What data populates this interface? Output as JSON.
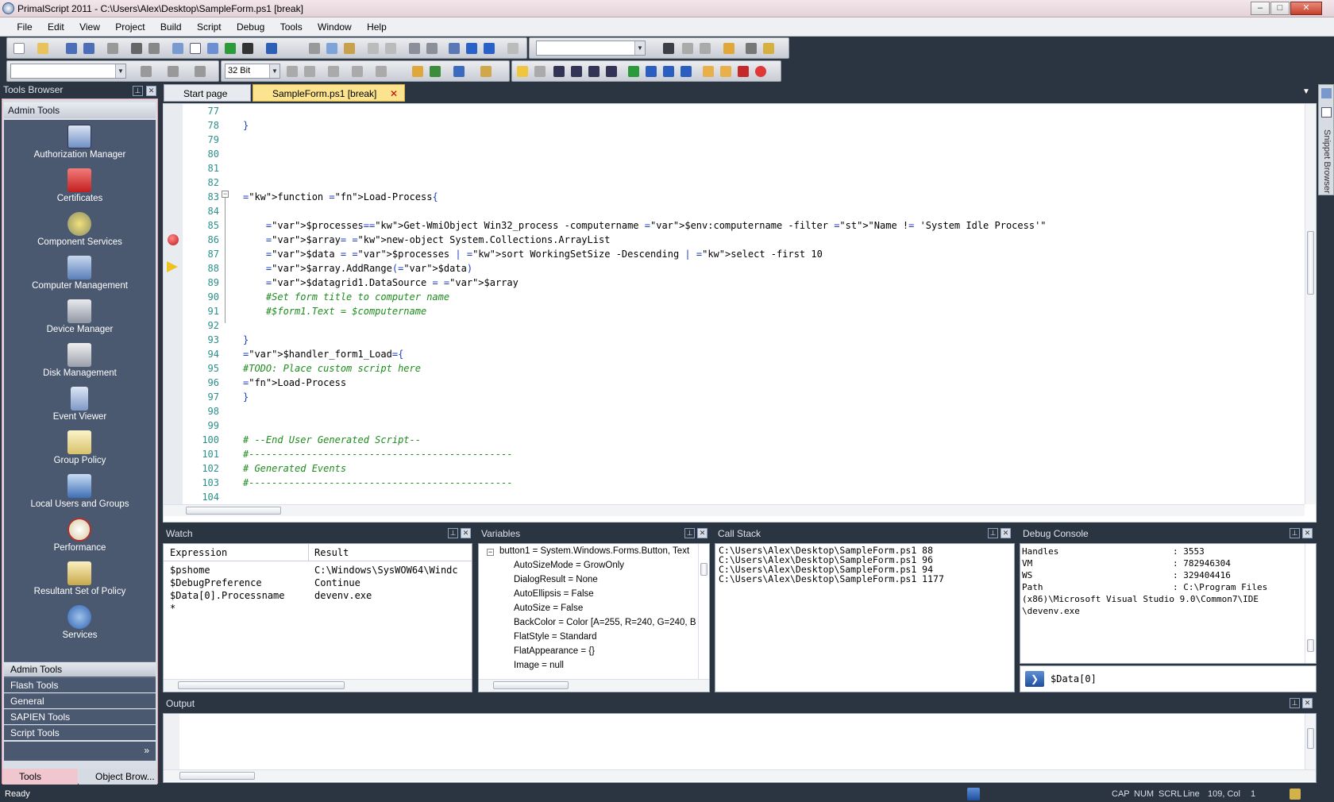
{
  "window": {
    "title": "PrimalScript 2011 - C:\\Users\\Alex\\Desktop\\SampleForm.ps1 [break]",
    "minimize": "–",
    "maximize": "□",
    "close": "✕"
  },
  "menu": [
    "File",
    "Edit",
    "View",
    "Project",
    "Build",
    "Script",
    "Debug",
    "Tools",
    "Window",
    "Help"
  ],
  "toolbar": {
    "platform": "32 Bit",
    "config_combo": "",
    "find_combo": ""
  },
  "tools_browser": {
    "title": "Tools Browser",
    "header": "Admin Tools",
    "items": [
      "Authorization Manager",
      "Certificates",
      "Component Services",
      "Computer Management",
      "Device Manager",
      "Disk Management",
      "Event Viewer",
      "Group Policy",
      "Local Users and Groups",
      "Performance",
      "Resultant Set of Policy",
      "Services"
    ],
    "categories": [
      "Admin Tools",
      "Flash Tools",
      "General",
      "SAPIEN Tools",
      "Script Tools"
    ],
    "tab_tools": "Tools Browser",
    "tab_object": "Object Brow..."
  },
  "tabs": {
    "start": "Start page",
    "file": "SampleForm.ps1 [break]"
  },
  "snippet_browser": "Snippet Browser",
  "code_lines": [
    {
      "n": "77",
      "t": ""
    },
    {
      "n": "78",
      "t": "}"
    },
    {
      "n": "79",
      "t": ""
    },
    {
      "n": "80",
      "t": ""
    },
    {
      "n": "81",
      "t": ""
    },
    {
      "n": "82",
      "t": ""
    },
    {
      "n": "83",
      "t": "function Load-Process{"
    },
    {
      "n": "84",
      "t": ""
    },
    {
      "n": "85",
      "t": "    $processes=Get-WmiObject Win32_process -computername $env:computername -filter \"Name != 'System Idle Process'\""
    },
    {
      "n": "86",
      "t": "    $array= new-object System.Collections.ArrayList"
    },
    {
      "n": "87",
      "t": "    $data = $processes | sort WorkingSetSize -Descending | select -first 10"
    },
    {
      "n": "88",
      "t": "    $array.AddRange($data)"
    },
    {
      "n": "89",
      "t": "    $datagrid1.DataSource = $array"
    },
    {
      "n": "90",
      "t": "    #Set form title to computer name"
    },
    {
      "n": "91",
      "t": "    #$form1.Text = $computername"
    },
    {
      "n": "92",
      "t": ""
    },
    {
      "n": "93",
      "t": "}"
    },
    {
      "n": "94",
      "t": "$handler_form1_Load={"
    },
    {
      "n": "95",
      "t": "#TODO: Place custom script here"
    },
    {
      "n": "96",
      "t": "Load-Process"
    },
    {
      "n": "97",
      "t": "}"
    },
    {
      "n": "98",
      "t": ""
    },
    {
      "n": "99",
      "t": ""
    },
    {
      "n": "100",
      "t": "# --End User Generated Script--"
    },
    {
      "n": "101",
      "t": "#----------------------------------------------"
    },
    {
      "n": "102",
      "t": "# Generated Events"
    },
    {
      "n": "103",
      "t": "#----------------------------------------------"
    },
    {
      "n": "104",
      "t": ""
    }
  ],
  "watch": {
    "title": "Watch",
    "col_expression": "Expression",
    "col_result": "Result",
    "rows": [
      {
        "e": "$pshome",
        "r": "C:\\Windows\\SysWOW64\\Windc"
      },
      {
        "e": "$DebugPreference",
        "r": "Continue"
      },
      {
        "e": "$Data[0].Processname",
        "r": "devenv.exe"
      },
      {
        "e": "*",
        "r": ""
      }
    ]
  },
  "variables": {
    "title": "Variables",
    "root": "button1 = System.Windows.Forms.Button, Text",
    "items": [
      "AutoSizeMode = GrowOnly",
      "DialogResult = None",
      "AutoEllipsis = False",
      "AutoSize = False",
      "BackColor = Color [A=255, R=240, G=240, B",
      "FlatStyle = Standard",
      "FlatAppearance = {}",
      "Image = null"
    ]
  },
  "call_stack": {
    "title": "Call Stack",
    "rows": [
      "C:\\Users\\Alex\\Desktop\\SampleForm.ps1 88",
      "C:\\Users\\Alex\\Desktop\\SampleForm.ps1 96",
      "C:\\Users\\Alex\\Desktop\\SampleForm.ps1 94",
      "C:\\Users\\Alex\\Desktop\\SampleForm.ps1 1177"
    ]
  },
  "debug_console": {
    "title": "Debug Console",
    "lines": [
      {
        "k": "Handles",
        "v": ": 3553"
      },
      {
        "k": "VM",
        "v": ": 782946304"
      },
      {
        "k": "WS",
        "v": ": 329404416"
      },
      {
        "k": "Path",
        "v": ": C:\\Program Files"
      },
      {
        "k": "(x86)\\Microsoft Visual Studio 9.0\\Common7\\IDE",
        "v": ""
      },
      {
        "k": "\\devenv.exe",
        "v": ""
      }
    ],
    "input": "$Data[0]"
  },
  "output": {
    "title": "Output"
  },
  "status": {
    "ready": "Ready",
    "cap": "CAP",
    "num": "NUM",
    "scrl": "SCRL",
    "line_label": "Line",
    "line": "109, Col",
    "col": "1"
  }
}
